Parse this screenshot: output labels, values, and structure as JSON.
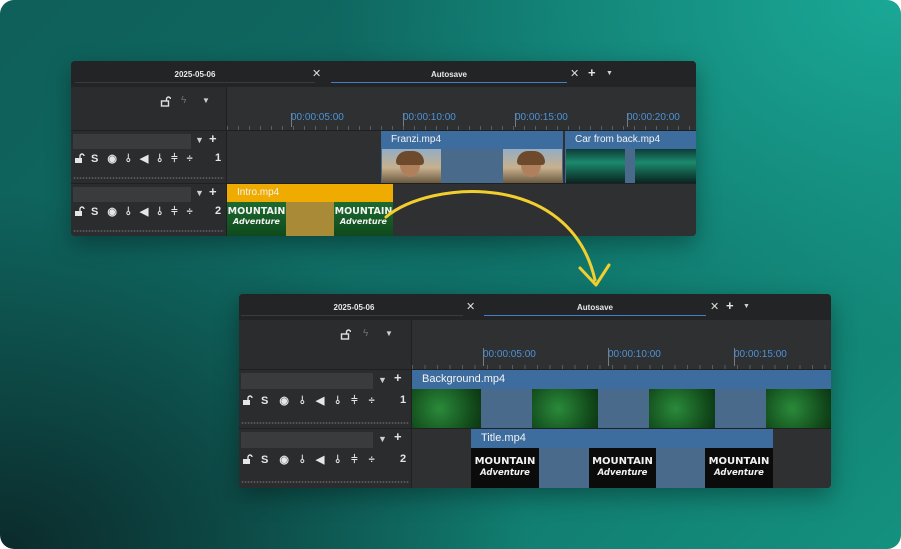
{
  "top": {
    "tabs": [
      {
        "label": "2025-05-06"
      },
      {
        "label": "Autosave"
      }
    ],
    "ruler": [
      "00:00:05:00",
      "00:00:10:00",
      "00:00:15:00",
      "00:00:20:00"
    ],
    "tracks": [
      {
        "num": "1",
        "clips": [
          {
            "title": "Franzi.mp4"
          },
          {
            "title": "Car from back.mp4"
          }
        ]
      },
      {
        "num": "2",
        "clips": [
          {
            "title": "Intro.mp4"
          }
        ]
      }
    ]
  },
  "bottom": {
    "tabs": [
      {
        "label": "2025-05-06"
      },
      {
        "label": "Autosave"
      }
    ],
    "ruler": [
      "00:00:05:00",
      "00:00:10:00",
      "00:00:15:00"
    ],
    "tracks": [
      {
        "num": "1",
        "clips": [
          {
            "title": "Background.mp4"
          }
        ]
      },
      {
        "num": "2",
        "clips": [
          {
            "title": "Title.mp4"
          }
        ]
      }
    ]
  },
  "icons": {
    "close": "×",
    "plus": "+",
    "dropdown": "▾",
    "lock": "lock-open-icon",
    "track_icons": "S ◉ ⫰ ◀ ⫰ ⫩ ÷"
  },
  "logo": {
    "line1": "MOUNTAIN",
    "line2": "Adventure"
  },
  "colors": {
    "accent": "#3f81c5",
    "selected_clip": "#f0ab00",
    "clip_header": "#3d6c9e",
    "arrow": "#f2cf2e"
  }
}
